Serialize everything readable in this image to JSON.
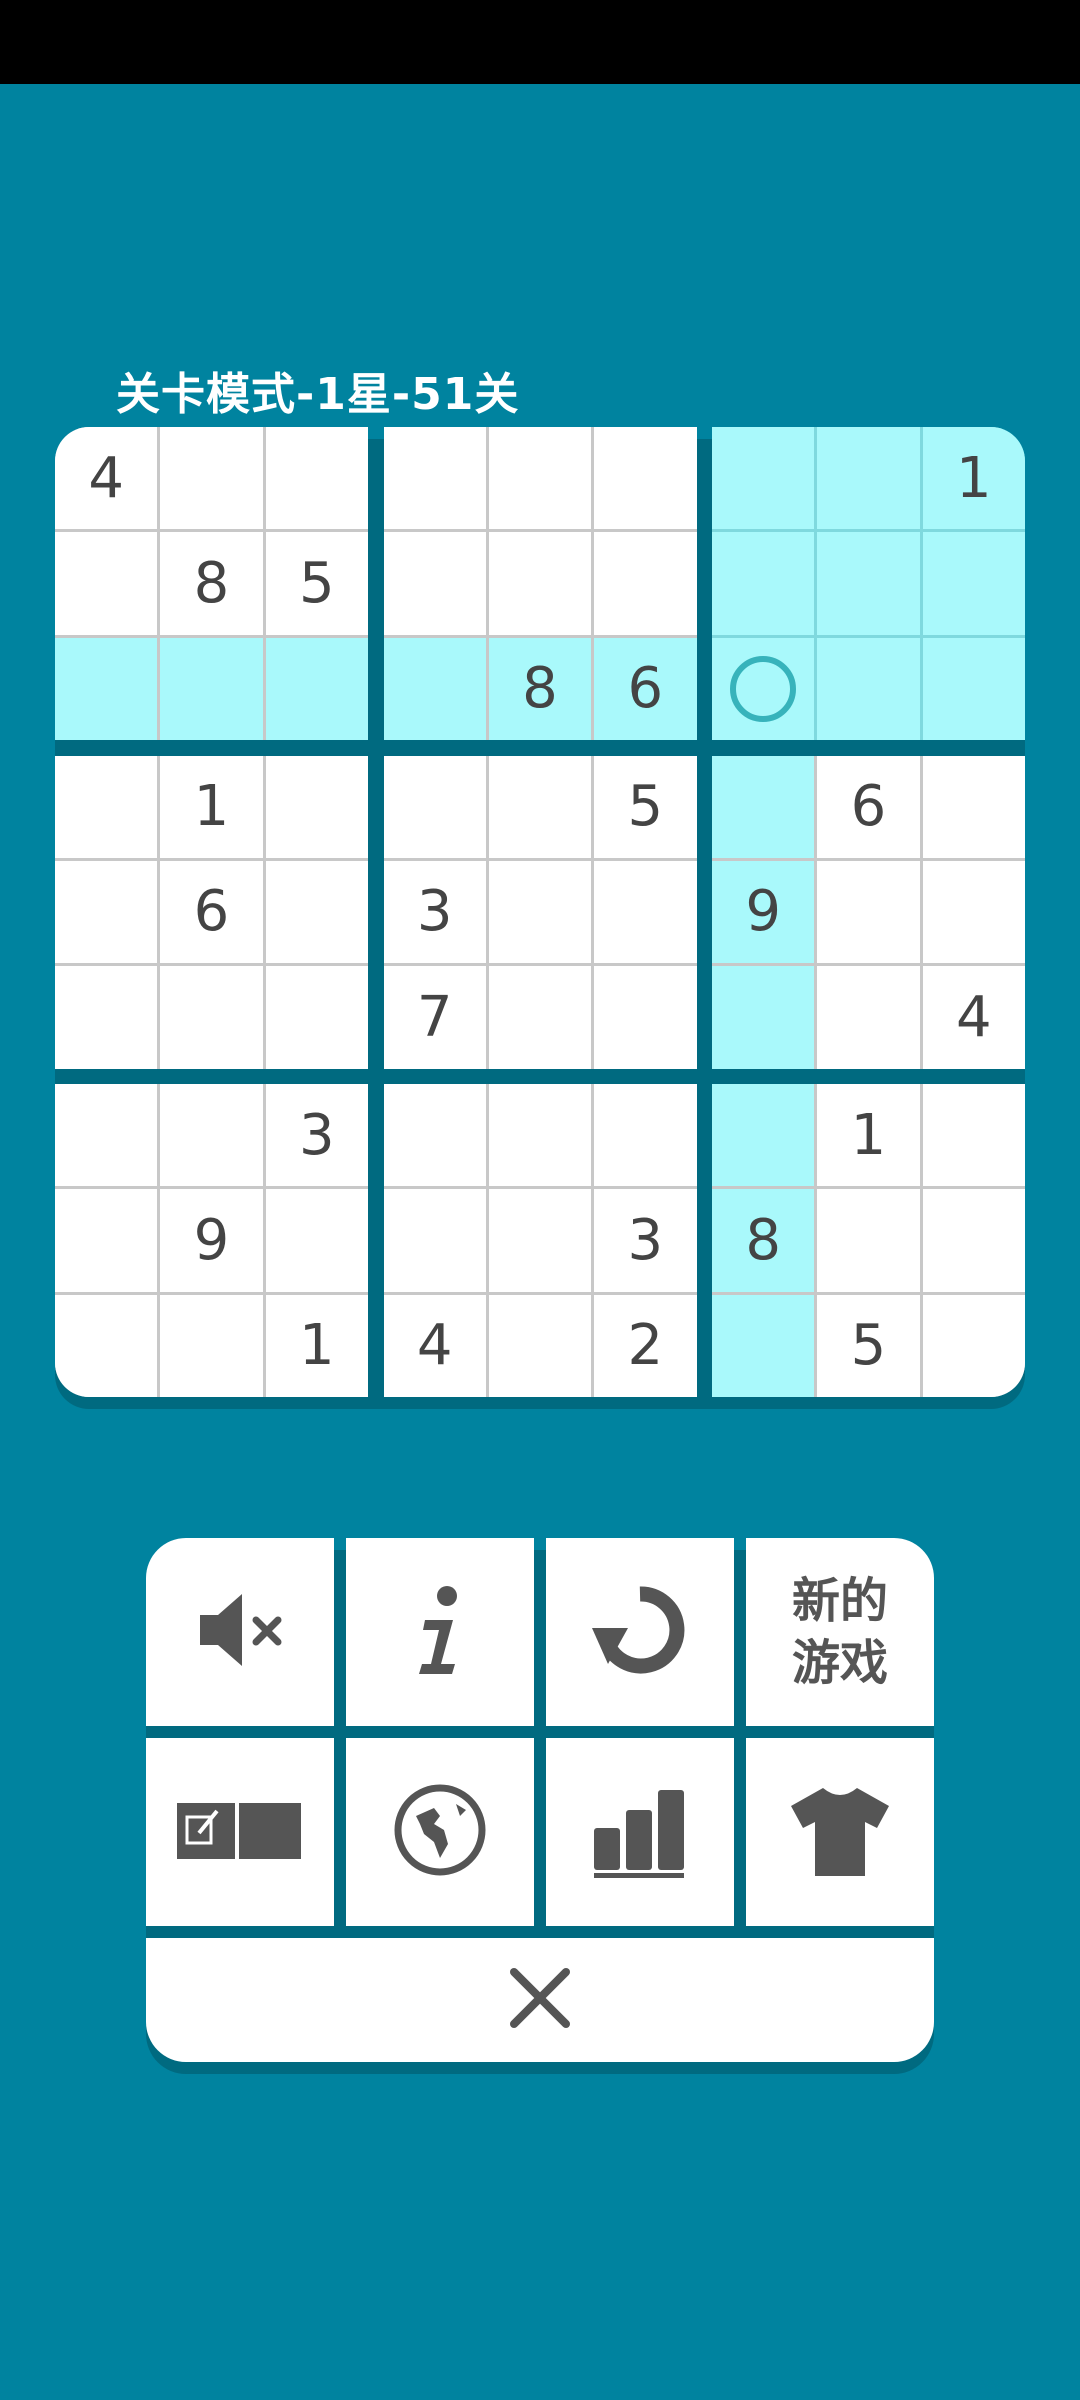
{
  "header": {
    "level_title": "关卡模式-1星-51关"
  },
  "colors": {
    "background": "#00839f",
    "highlight": "#a9f9fb",
    "selection_ring": "#37b3bb",
    "digit": "#444444"
  },
  "board": {
    "selected_cell": {
      "row": 2,
      "col": 6
    },
    "rows": [
      [
        "4",
        "",
        "",
        "",
        "",
        "",
        "",
        "",
        "1"
      ],
      [
        "",
        "8",
        "5",
        "",
        "",
        "",
        "",
        "",
        ""
      ],
      [
        "",
        "",
        "",
        "",
        "8",
        "6",
        "",
        "",
        ""
      ],
      [
        "",
        "1",
        "",
        "",
        "",
        "5",
        "",
        "6",
        ""
      ],
      [
        "",
        "6",
        "",
        "3",
        "",
        "",
        "9",
        "",
        ""
      ],
      [
        "",
        "",
        "",
        "7",
        "",
        "",
        "",
        "",
        "4"
      ],
      [
        "",
        "",
        "3",
        "",
        "",
        "",
        "",
        "1",
        ""
      ],
      [
        "",
        "9",
        "",
        "",
        "",
        "3",
        "8",
        "",
        ""
      ],
      [
        "",
        "",
        "1",
        "4",
        "",
        "2",
        "",
        "5",
        ""
      ]
    ]
  },
  "menu": {
    "new_game_label": "新的游戏",
    "icons": [
      "mute-icon",
      "info-icon",
      "restart-icon",
      "new-game",
      "notes-icon",
      "globe-icon",
      "stats-icon",
      "shirt-icon"
    ],
    "close_icon": "close-icon"
  }
}
